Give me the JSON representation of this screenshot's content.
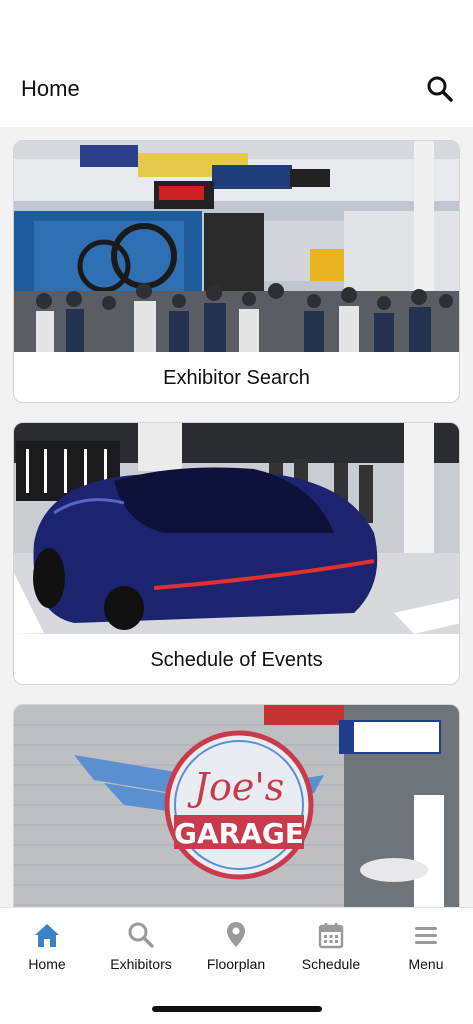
{
  "header": {
    "title": "Home",
    "search_icon": "search-icon"
  },
  "cards": [
    {
      "label": "Exhibitor Search",
      "image": "trade-show-crowd-photo"
    },
    {
      "label": "Schedule of Events",
      "image": "blue-sports-car-photo"
    },
    {
      "label": "",
      "image": "joes-garage-mural-photo",
      "mural_text_line1": "Joe's",
      "mural_text_line2": "GARAGE"
    }
  ],
  "tabbar": {
    "tabs": [
      {
        "label": "Home",
        "icon": "house-icon",
        "active": true
      },
      {
        "label": "Exhibitors",
        "icon": "search-icon",
        "active": false
      },
      {
        "label": "Floorplan",
        "icon": "map-pin-icon",
        "active": false
      },
      {
        "label": "Schedule",
        "icon": "calendar-icon",
        "active": false
      },
      {
        "label": "Menu",
        "icon": "hamburger-menu-icon",
        "active": false
      }
    ],
    "active_color": "#3a84c4",
    "inactive_color": "#9a9a9a"
  }
}
